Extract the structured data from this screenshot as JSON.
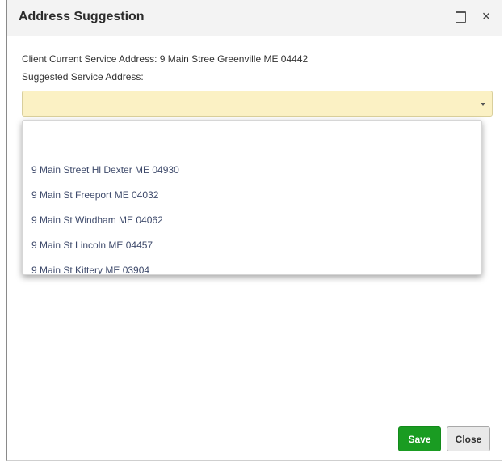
{
  "dialog": {
    "title": "Address Suggestion"
  },
  "window_controls": {
    "close_glyph": "×"
  },
  "form": {
    "current_address_label": "Client Current Service Address: 9 Main Stree Greenville ME 04442",
    "suggested_address_label": "Suggested Service Address:",
    "suggested_address_value": ""
  },
  "dropdown": {
    "options": [
      "",
      "9 Main Street Hl Dexter ME 04930",
      "9 Main St Freeport ME 04032",
      "9 Main St Windham ME 04062",
      "9 Main St Lincoln ME 04457",
      "9 Main St Kittery ME 03904"
    ]
  },
  "buttons": {
    "save_label": "Save",
    "close_label": "Close"
  },
  "colors": {
    "input_background": "#fbf1c4",
    "save_button": "#1a9c22",
    "option_text": "#3e4a6b"
  }
}
